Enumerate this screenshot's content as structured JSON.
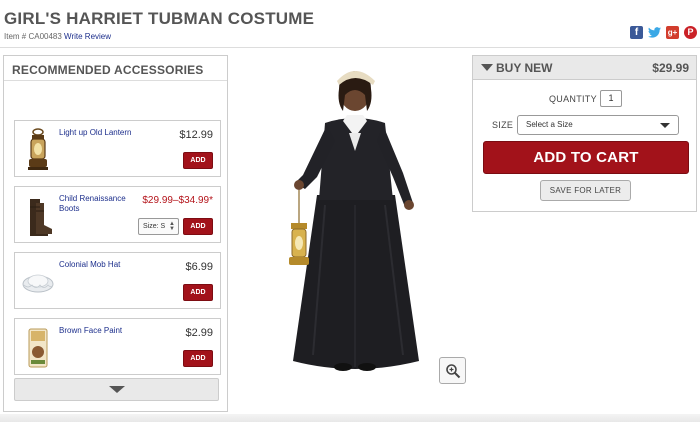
{
  "product": {
    "title": "GIRL'S HARRIET TUBMAN COSTUME",
    "item_label": "Item # CA00483",
    "review_link": "Write Review"
  },
  "social": {
    "icons": [
      "facebook-icon",
      "twitter-icon",
      "google-plus-icon",
      "pinterest-icon"
    ],
    "facebook_glyph": "f",
    "twitter_glyph": "🐦",
    "google_glyph": "g+",
    "pinterest_glyph": "P"
  },
  "accessories": {
    "title": "RECOMMENDED ACCESSORIES",
    "items": [
      {
        "name": "Light up Old Lantern",
        "price": "$12.99",
        "add": "ADD"
      },
      {
        "name": "Child Renaissance Boots",
        "price": "$29.99–$34.99*",
        "size": "Size: S",
        "add": "ADD"
      },
      {
        "name": "Colonial Mob Hat",
        "price": "$6.99",
        "add": "ADD"
      },
      {
        "name": "Brown Face Paint",
        "price": "$2.99",
        "add": "ADD"
      }
    ]
  },
  "buy": {
    "title": "BUY NEW",
    "price": "$29.99",
    "quantity_label": "QUANTITY",
    "quantity_value": "1",
    "size_label": "SIZE",
    "size_placeholder": "Select a Size",
    "add_to_cart": "ADD TO CART",
    "save_for_later": "SAVE FOR LATER"
  },
  "colors": {
    "accent_red": "#a2121a",
    "link_blue": "#1d2f8c",
    "panel_gray": "#e9e9e9"
  }
}
